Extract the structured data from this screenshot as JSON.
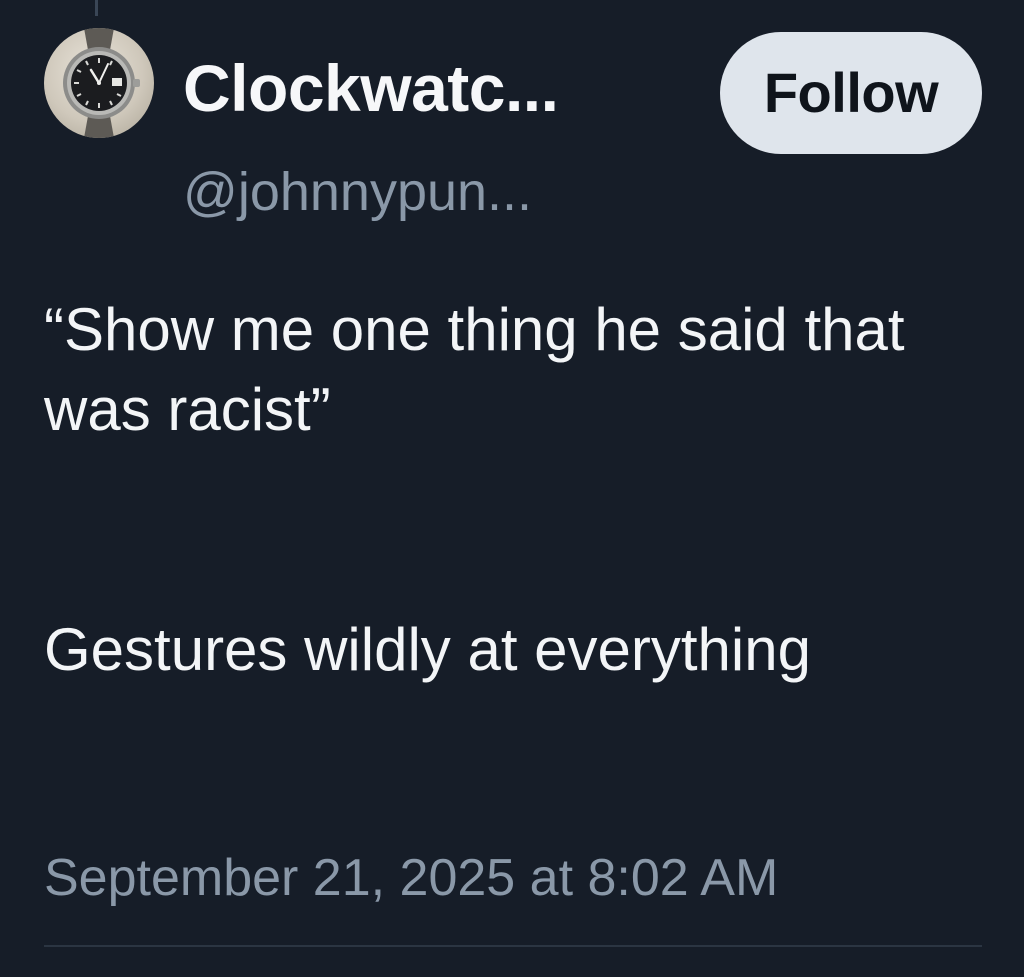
{
  "author": {
    "display_name": "Clockwatc...",
    "handle": "@johnnypun...",
    "avatar_icon": "wristwatch-icon"
  },
  "follow_button": {
    "label": "Follow"
  },
  "tweet": {
    "paragraphs": [
      "“Show me one thing he said that was racist”",
      "Gestures wildly at everything"
    ],
    "timestamp": "September 21, 2025 at 8:02 AM"
  },
  "colors": {
    "background": "#161d28",
    "text_primary": "#f3f5f7",
    "text_secondary": "#8a98a8",
    "follow_button_bg": "#dfe5ec",
    "follow_button_text": "#0f141b"
  }
}
